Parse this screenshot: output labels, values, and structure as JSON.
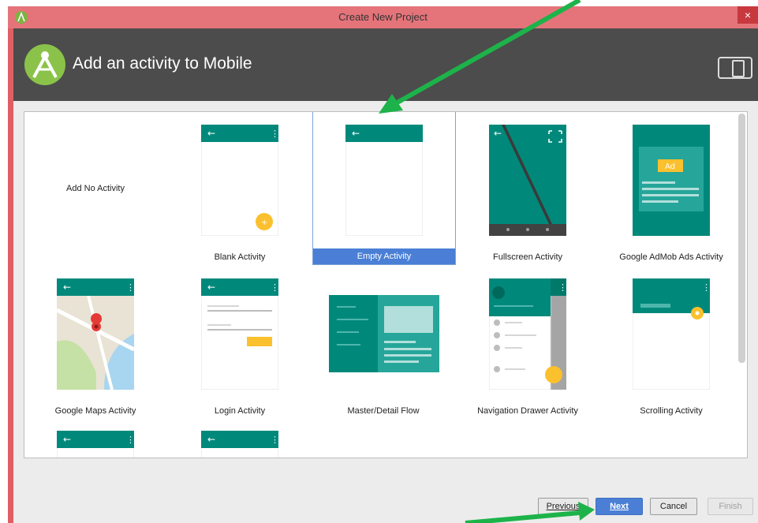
{
  "window": {
    "title": "Create New Project",
    "close_glyph": "×"
  },
  "header": {
    "title": "Add an activity to Mobile"
  },
  "activities": [
    {
      "label": "Add No Activity",
      "selected": false
    },
    {
      "label": "Blank Activity",
      "selected": false
    },
    {
      "label": "Empty Activity",
      "selected": true
    },
    {
      "label": "Fullscreen Activity",
      "selected": false
    },
    {
      "label": "Google AdMob Ads Activity",
      "selected": false
    },
    {
      "label": "Google Maps Activity",
      "selected": false
    },
    {
      "label": "Login Activity",
      "selected": false
    },
    {
      "label": "Master/Detail Flow",
      "selected": false
    },
    {
      "label": "Navigation Drawer Activity",
      "selected": false
    },
    {
      "label": "Scrolling Activity",
      "selected": false
    }
  ],
  "thumbs": {
    "ad_badge": "Ad",
    "back_glyph": "←",
    "menu_glyph": "⋮"
  },
  "buttons": {
    "previous": "Previous",
    "next": "Next",
    "cancel": "Cancel",
    "finish": "Finish"
  },
  "colors": {
    "teal": "#00897b",
    "dark_teal": "#00796b",
    "accent": "#fbc02d",
    "selection": "#4a7fd5",
    "arrow": "#1db34a"
  }
}
